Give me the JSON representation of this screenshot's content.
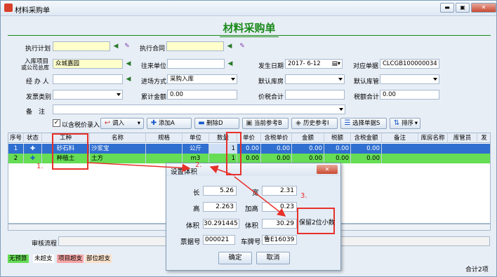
{
  "window": {
    "title": "材料采购单",
    "min": "▬",
    "max": "▣",
    "close": "✕"
  },
  "heading": "材料采购单",
  "form": {
    "plan_label": "执行计划",
    "contract_label": "执行合同",
    "project_label_1": "入库项目",
    "project_label_2": "或公司总库",
    "project_value": "众城嘉园",
    "partner_label": "往来单位",
    "date_label": "发生日期",
    "date_value": "2017- 6-12",
    "ref_label": "对应单据",
    "ref_value": "CLCGB100000034",
    "handler_label": "经 办 人",
    "inmode_label": "进场方式",
    "inmode_value": "采购入库",
    "warehouse_label": "默认库房",
    "keeper_label": "默认库管",
    "invoice_label": "发票类别",
    "amount_label": "累计金额",
    "amount_value": "0.00",
    "pricetax_label": "价税合计",
    "tax_label": "税额合计",
    "tax_value": "0.00",
    "remark_label": "备　注"
  },
  "toolbar": {
    "checkbox_label": "以含税价录入",
    "import": "调入",
    "add": "添加A",
    "delete": "删除D",
    "current_ref": "当前参考B",
    "history_ref": "历史参考I",
    "select": "选择单据S",
    "sort": "排序"
  },
  "columns": [
    "序号",
    "状态",
    "工种",
    "名称",
    "规格",
    "单位",
    "数量",
    "单价",
    "含税单价",
    "金额",
    "税额",
    "含税金额",
    "备注",
    "库房名称",
    "库管员",
    "发"
  ],
  "rows": [
    {
      "no": "1",
      "type": "砂石料",
      "name": "沙浆宝",
      "spec": "",
      "unit": "公斤",
      "qty": "1",
      "price": "0.00",
      "taxprice": "0.00",
      "amount": "0.00",
      "tax": "0.00",
      "taxamount": "0.00"
    },
    {
      "no": "2",
      "type": "种植土",
      "name": "土方",
      "spec": "",
      "unit": "m3",
      "qty": "1",
      "price": "0.00",
      "taxprice": "0.00",
      "amount": "0.00",
      "tax": "0.00",
      "taxamount": "0.00"
    }
  ],
  "bottom": {
    "review_label": "审核流程",
    "legend": [
      "无预算",
      "未超支",
      "项目超支",
      "部位超支"
    ],
    "total": "合计2项"
  },
  "dialog": {
    "title": "设置体积",
    "length_label": "长",
    "length": "5.26",
    "width_label": "宽",
    "width": "2.31",
    "height_label": "高",
    "height": "2.263",
    "extra_label": "加高",
    "extra": "0.23",
    "volume_label": "体积",
    "volume": "30.291445",
    "volume2_label": "体积",
    "volume2": "30.29",
    "ticket_label": "票据号",
    "ticket": "000021",
    "plate_label": "车牌号",
    "plate": "鲁E16039",
    "ok": "确定",
    "cancel": "取消"
  },
  "annotations": {
    "a1": "1.",
    "a2": "2.",
    "a3": "3.",
    "note": "保留2位小数"
  },
  "colors": {
    "heading": "#1a8a1a",
    "selected_row": "#2f6fd0",
    "green_row": "#66dd55",
    "annotation": "#e8302a"
  }
}
